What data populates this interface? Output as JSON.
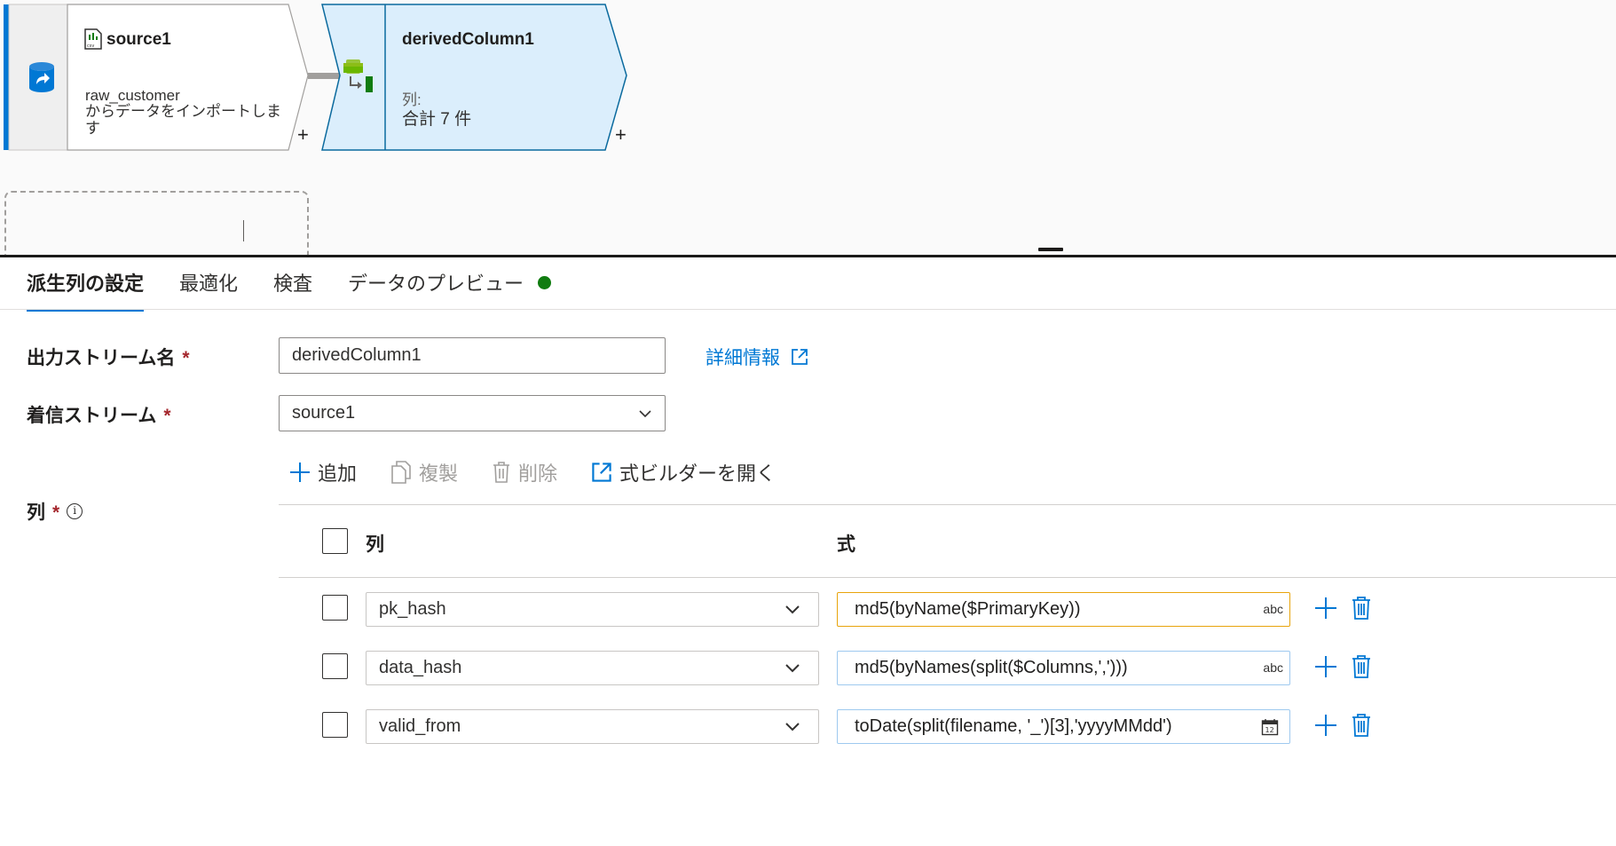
{
  "canvas": {
    "source_node": {
      "title": "source1",
      "desc_line1": "raw_customer",
      "desc_line2": "からデータをインポートしま",
      "desc_line3": "す"
    },
    "derived_node": {
      "title": "derivedColumn1",
      "cols_label": "列:",
      "cols_total": "合計 7 件"
    },
    "plus": "+"
  },
  "tabs": [
    {
      "label": "派生列の設定"
    },
    {
      "label": "最適化"
    },
    {
      "label": "検査"
    },
    {
      "label": "データのプレビュー"
    }
  ],
  "form": {
    "output_stream_label": "出力ストリーム名",
    "output_stream_value": "derivedColumn1",
    "required_mark": "*",
    "more_info_link": "詳細情報",
    "incoming_stream_label": "着信ストリーム",
    "incoming_stream_value": "source1",
    "columns_label": "列",
    "info_glyph": "i"
  },
  "toolbar": {
    "add": "追加",
    "duplicate": "複製",
    "delete": "削除",
    "open_builder": "式ビルダーを開く"
  },
  "table": {
    "col_header": "列",
    "expr_header": "式",
    "rows": [
      {
        "column": "pk_hash",
        "expression": "md5(byName($PrimaryKey))",
        "type_badge": "abc"
      },
      {
        "column": "data_hash",
        "expression": "md5(byNames(split($Columns,',')))",
        "type_badge": "abc"
      },
      {
        "column": "valid_from",
        "expression": "toDate(split(filename, '_')[3],'yyyyMMdd')",
        "type_badge": "date-icon"
      }
    ]
  },
  "colors": {
    "accent": "#0078d4",
    "status_green": "#107c10",
    "node_selected": "#dbeefc",
    "focus_border": "#e8a40c"
  }
}
